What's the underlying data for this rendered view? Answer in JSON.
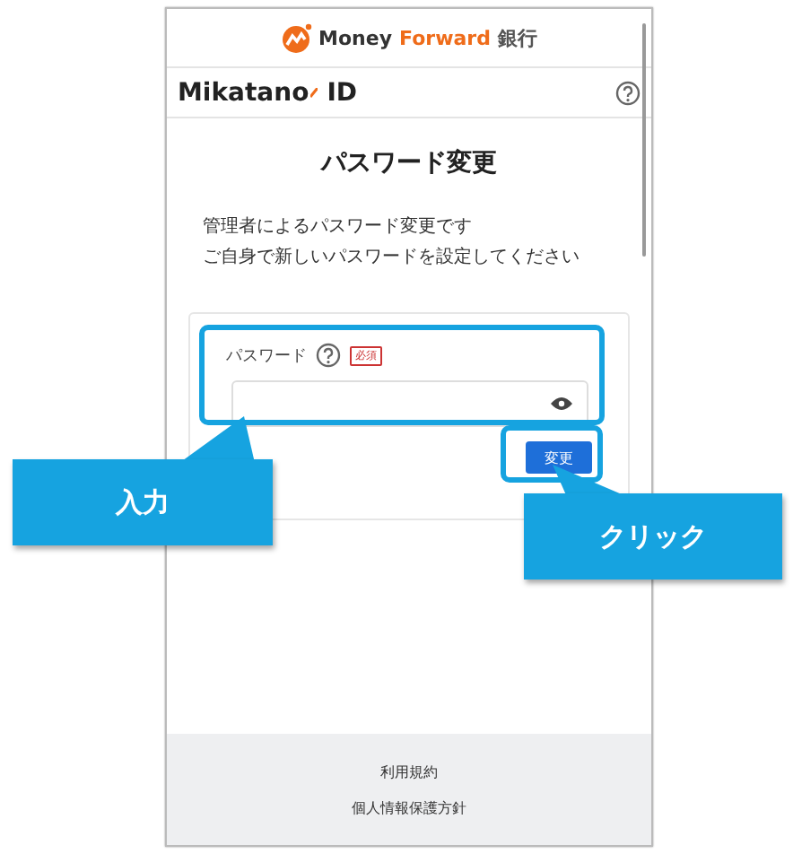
{
  "header": {
    "brand_primary": "Money",
    "brand_accent": "Forward",
    "brand_suffix": "銀行"
  },
  "app_bar": {
    "name": "Mikatano",
    "suffix": "ID"
  },
  "title": "パスワード変更",
  "description": [
    "管理者によるパスワード変更です",
    "ご自身で新しいパスワードを設定してください"
  ],
  "form": {
    "label": "パスワード",
    "required_badge": "必須",
    "submit": "変更"
  },
  "footer": {
    "links": [
      "利用規約",
      "個人情報保護方針"
    ]
  },
  "callouts": [
    {
      "text": "入力"
    },
    {
      "text": "クリック"
    }
  ]
}
